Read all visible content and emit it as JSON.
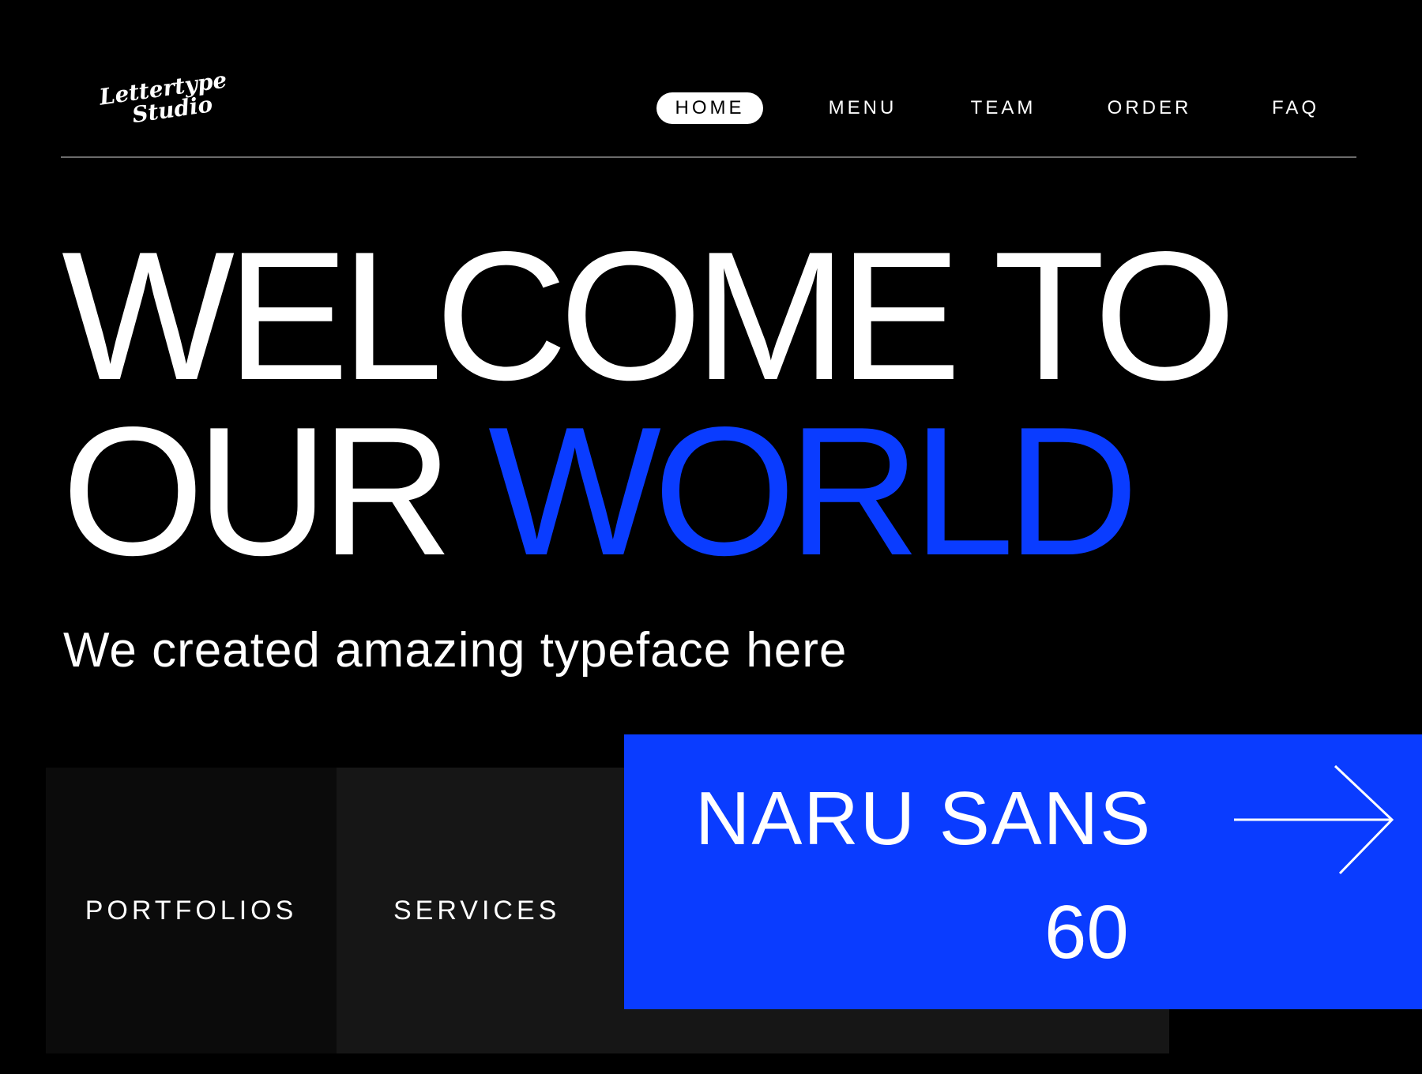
{
  "brand": {
    "logo_line1": "Lettertype",
    "logo_line2": "Studio"
  },
  "nav": {
    "items": [
      {
        "label": "HOME",
        "active": true
      },
      {
        "label": "MENU",
        "active": false
      },
      {
        "label": "TEAM",
        "active": false
      },
      {
        "label": "ORDER",
        "active": false
      },
      {
        "label": "FAQ",
        "active": false
      }
    ]
  },
  "hero": {
    "line1": "WELCOME TO",
    "line2_plain": "OUR ",
    "line2_accent": "WORLD",
    "subtitle": "We created amazing typeface here"
  },
  "cards": {
    "portfolios": "PORTFOLIOS",
    "services": "SERVICES"
  },
  "feature": {
    "name": "NARU SANS",
    "number": "60",
    "icon": "arrow-right-icon"
  },
  "colors": {
    "background": "#000000",
    "accent": "#0a3cff",
    "text": "#ffffff",
    "card_dark": "#0b0b0b",
    "card_mid": "#161616",
    "divider": "#6b6b6b"
  }
}
